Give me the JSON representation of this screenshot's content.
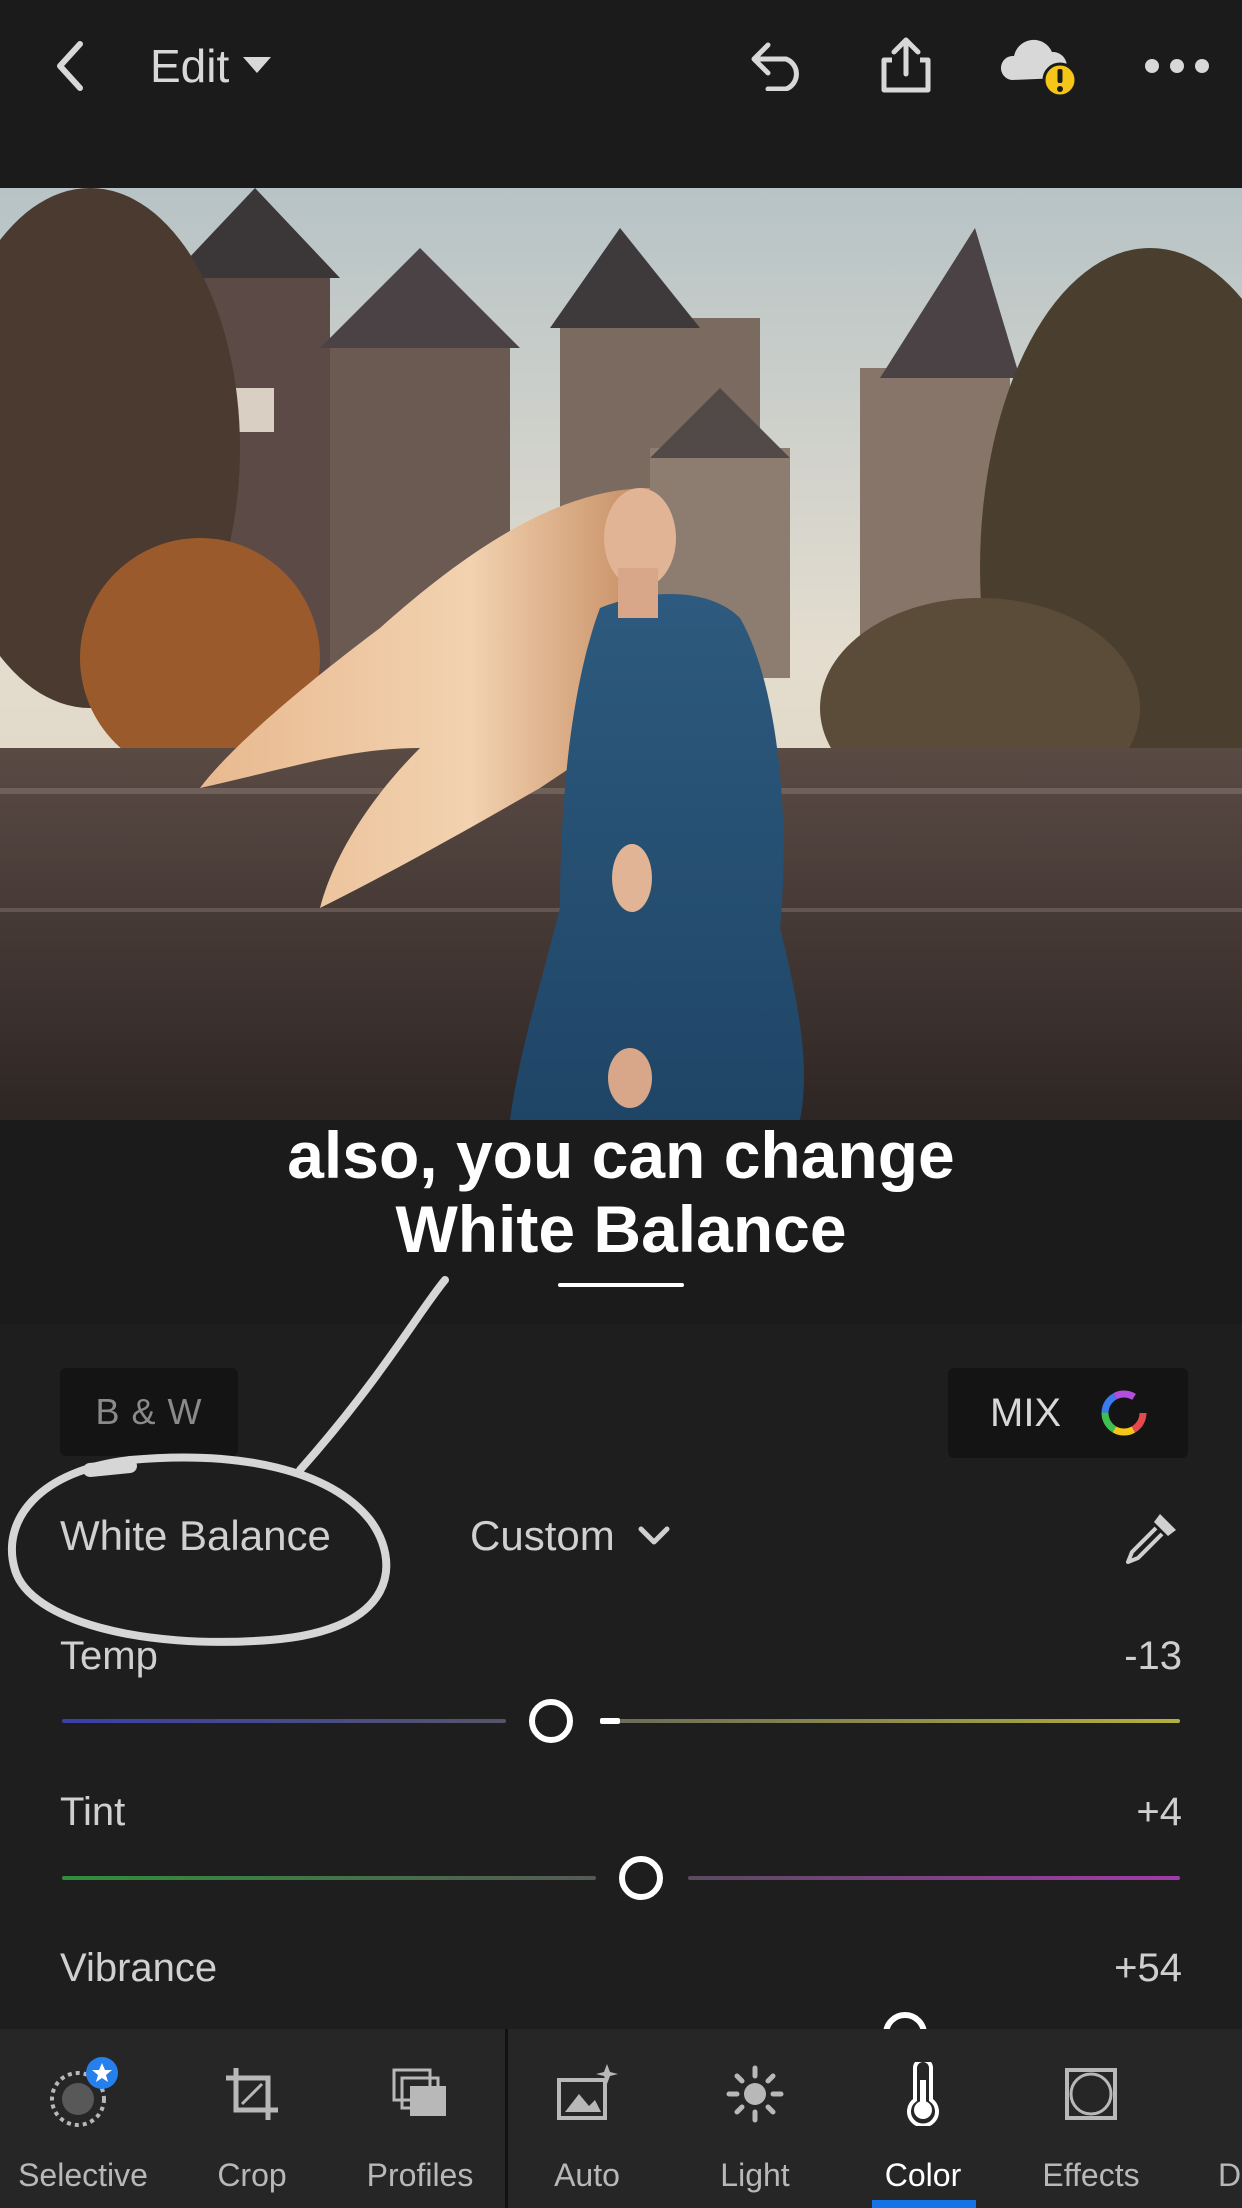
{
  "header": {
    "edit_label": "Edit"
  },
  "caption": {
    "line1": "also, you can change",
    "line2": "White Balance"
  },
  "panel": {
    "bw_label": "B & W",
    "mix_label": "MIX",
    "white_balance_label": "White Balance",
    "white_balance_value": "Custom",
    "sliders": [
      {
        "label": "Temp",
        "value": "-13"
      },
      {
        "label": "Tint",
        "value": "+4"
      },
      {
        "label": "Vibrance",
        "value": "+54"
      }
    ]
  },
  "bottom_nav": {
    "items": [
      {
        "label": "Selective",
        "icon": "selective-icon"
      },
      {
        "label": "Crop",
        "icon": "crop-icon"
      },
      {
        "label": "Profiles",
        "icon": "profiles-icon"
      },
      {
        "label": "Auto",
        "icon": "auto-icon"
      },
      {
        "label": "Light",
        "icon": "light-icon"
      },
      {
        "label": "Color",
        "icon": "color-icon",
        "active": true
      },
      {
        "label": "Effects",
        "icon": "effects-icon"
      },
      {
        "label": "D"
      }
    ]
  },
  "colors": {
    "background": "#1c1c1d",
    "active_tab": "#1473e6",
    "warning": "#f5c518"
  }
}
